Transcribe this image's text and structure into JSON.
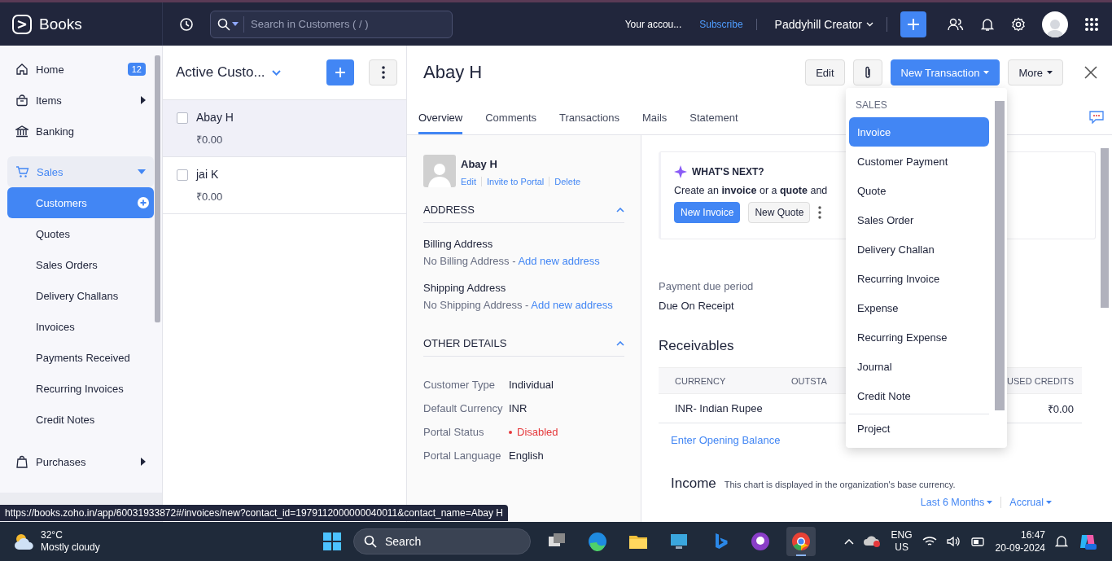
{
  "app": {
    "name": "Books"
  },
  "topbar": {
    "search_placeholder": "Search in Customers ( / )",
    "account": "Your accou...",
    "subscribe": "Subscribe",
    "organization": "Paddyhill Creator"
  },
  "sidebar": {
    "items": [
      {
        "label": "Home",
        "kind": "link",
        "selected": false,
        "badge": "12"
      },
      {
        "label": "Items",
        "kind": "group",
        "selected": false,
        "expanded": false
      },
      {
        "label": "Banking",
        "kind": "link",
        "selected": false
      },
      {
        "label": "Sales",
        "kind": "group",
        "selected": true,
        "expanded": true,
        "children": [
          {
            "label": "Customers",
            "selected": true
          },
          {
            "label": "Quotes",
            "selected": false
          },
          {
            "label": "Sales Orders",
            "selected": false
          },
          {
            "label": "Delivery Challans",
            "selected": false
          },
          {
            "label": "Invoices",
            "selected": false
          },
          {
            "label": "Payments Received",
            "selected": false
          },
          {
            "label": "Recurring Invoices",
            "selected": false
          },
          {
            "label": "Credit Notes",
            "selected": false
          }
        ]
      },
      {
        "label": "Purchases",
        "kind": "group",
        "selected": false,
        "expanded": false
      }
    ]
  },
  "customer_list": {
    "title": "Active Custo...",
    "customers": [
      {
        "name": "Abay H",
        "amount": "₹0.00",
        "selected": true,
        "checked": false
      },
      {
        "name": "jai K",
        "amount": "₹0.00",
        "selected": false,
        "checked": false
      }
    ]
  },
  "detail": {
    "name": "Abay H",
    "actions": {
      "edit": "Edit",
      "new_transaction": "New Transaction",
      "more": "More"
    },
    "tabs": [
      {
        "label": "Overview",
        "selected": true
      },
      {
        "label": "Comments",
        "selected": false
      },
      {
        "label": "Transactions",
        "selected": false
      },
      {
        "label": "Mails",
        "selected": false
      },
      {
        "label": "Statement",
        "selected": false
      }
    ],
    "contact": {
      "name": "Abay H",
      "links": [
        "Edit",
        "Invite to Portal",
        "Delete"
      ]
    },
    "address": {
      "title": "ADDRESS",
      "expanded": true,
      "entries": [
        {
          "label": "Billing Address",
          "value": "No Billing Address",
          "separator": "-",
          "link": "Add new address"
        },
        {
          "label": "Shipping Address",
          "value": "No Shipping Address",
          "separator": "-",
          "link": "Add new address"
        }
      ]
    },
    "other_details": {
      "title": "OTHER DETAILS",
      "expanded": true,
      "rows": [
        {
          "label": "Customer Type",
          "value": "Individual",
          "kind": "text"
        },
        {
          "label": "Default Currency",
          "value": "INR",
          "kind": "text"
        },
        {
          "label": "Portal Status",
          "value": "Disabled",
          "kind": "status"
        },
        {
          "label": "Portal Language",
          "value": "English",
          "kind": "text"
        }
      ]
    },
    "whats_next": {
      "title": "WHAT'S NEXT?",
      "text": "Create an **invoice** or a **quote** and",
      "buttons": [
        {
          "label": "New Invoice",
          "kind": "primary"
        },
        {
          "label": "New Quote",
          "kind": "secondary"
        }
      ]
    },
    "payment_terms": {
      "label": "Payment due period",
      "value": "Due On Receipt"
    },
    "receivables": {
      "title": "Receivables",
      "columns": [
        "CURRENCY",
        "OUTSTA",
        "USED CREDITS"
      ],
      "rows": [
        {
          "currency": "INR- Indian Rupee",
          "used_credits": "₹0.00"
        }
      ],
      "link": "Enter Opening Balance"
    },
    "income": {
      "title": "Income",
      "note": "This chart is displayed in the organization's base currency.",
      "filters": [
        "Last 6 Months",
        "Accrual"
      ]
    }
  },
  "transaction_menu": {
    "section": "SALES",
    "items": [
      {
        "label": "Invoice",
        "selected": true
      },
      {
        "label": "Customer Payment",
        "selected": false
      },
      {
        "label": "Quote",
        "selected": false
      },
      {
        "label": "Sales Order",
        "selected": false
      },
      {
        "label": "Delivery Challan",
        "selected": false
      },
      {
        "label": "Recurring Invoice",
        "selected": false
      },
      {
        "label": "Expense",
        "selected": false
      },
      {
        "label": "Recurring Expense",
        "selected": false
      },
      {
        "label": "Journal",
        "selected": false
      },
      {
        "label": "Credit Note",
        "selected": false
      },
      {
        "label": "Project",
        "selected": false
      }
    ]
  },
  "status_url": "https://books.zoho.in/app/60031933872#/invoices/new?contact_id=1979112000000040011&contact_name=Abay H",
  "taskbar": {
    "weather": {
      "temp": "32°C",
      "desc": "Mostly cloudy"
    },
    "search_placeholder": "Search",
    "language": [
      "ENG",
      "US"
    ],
    "time": "16:47",
    "date": "20-09-2024"
  }
}
